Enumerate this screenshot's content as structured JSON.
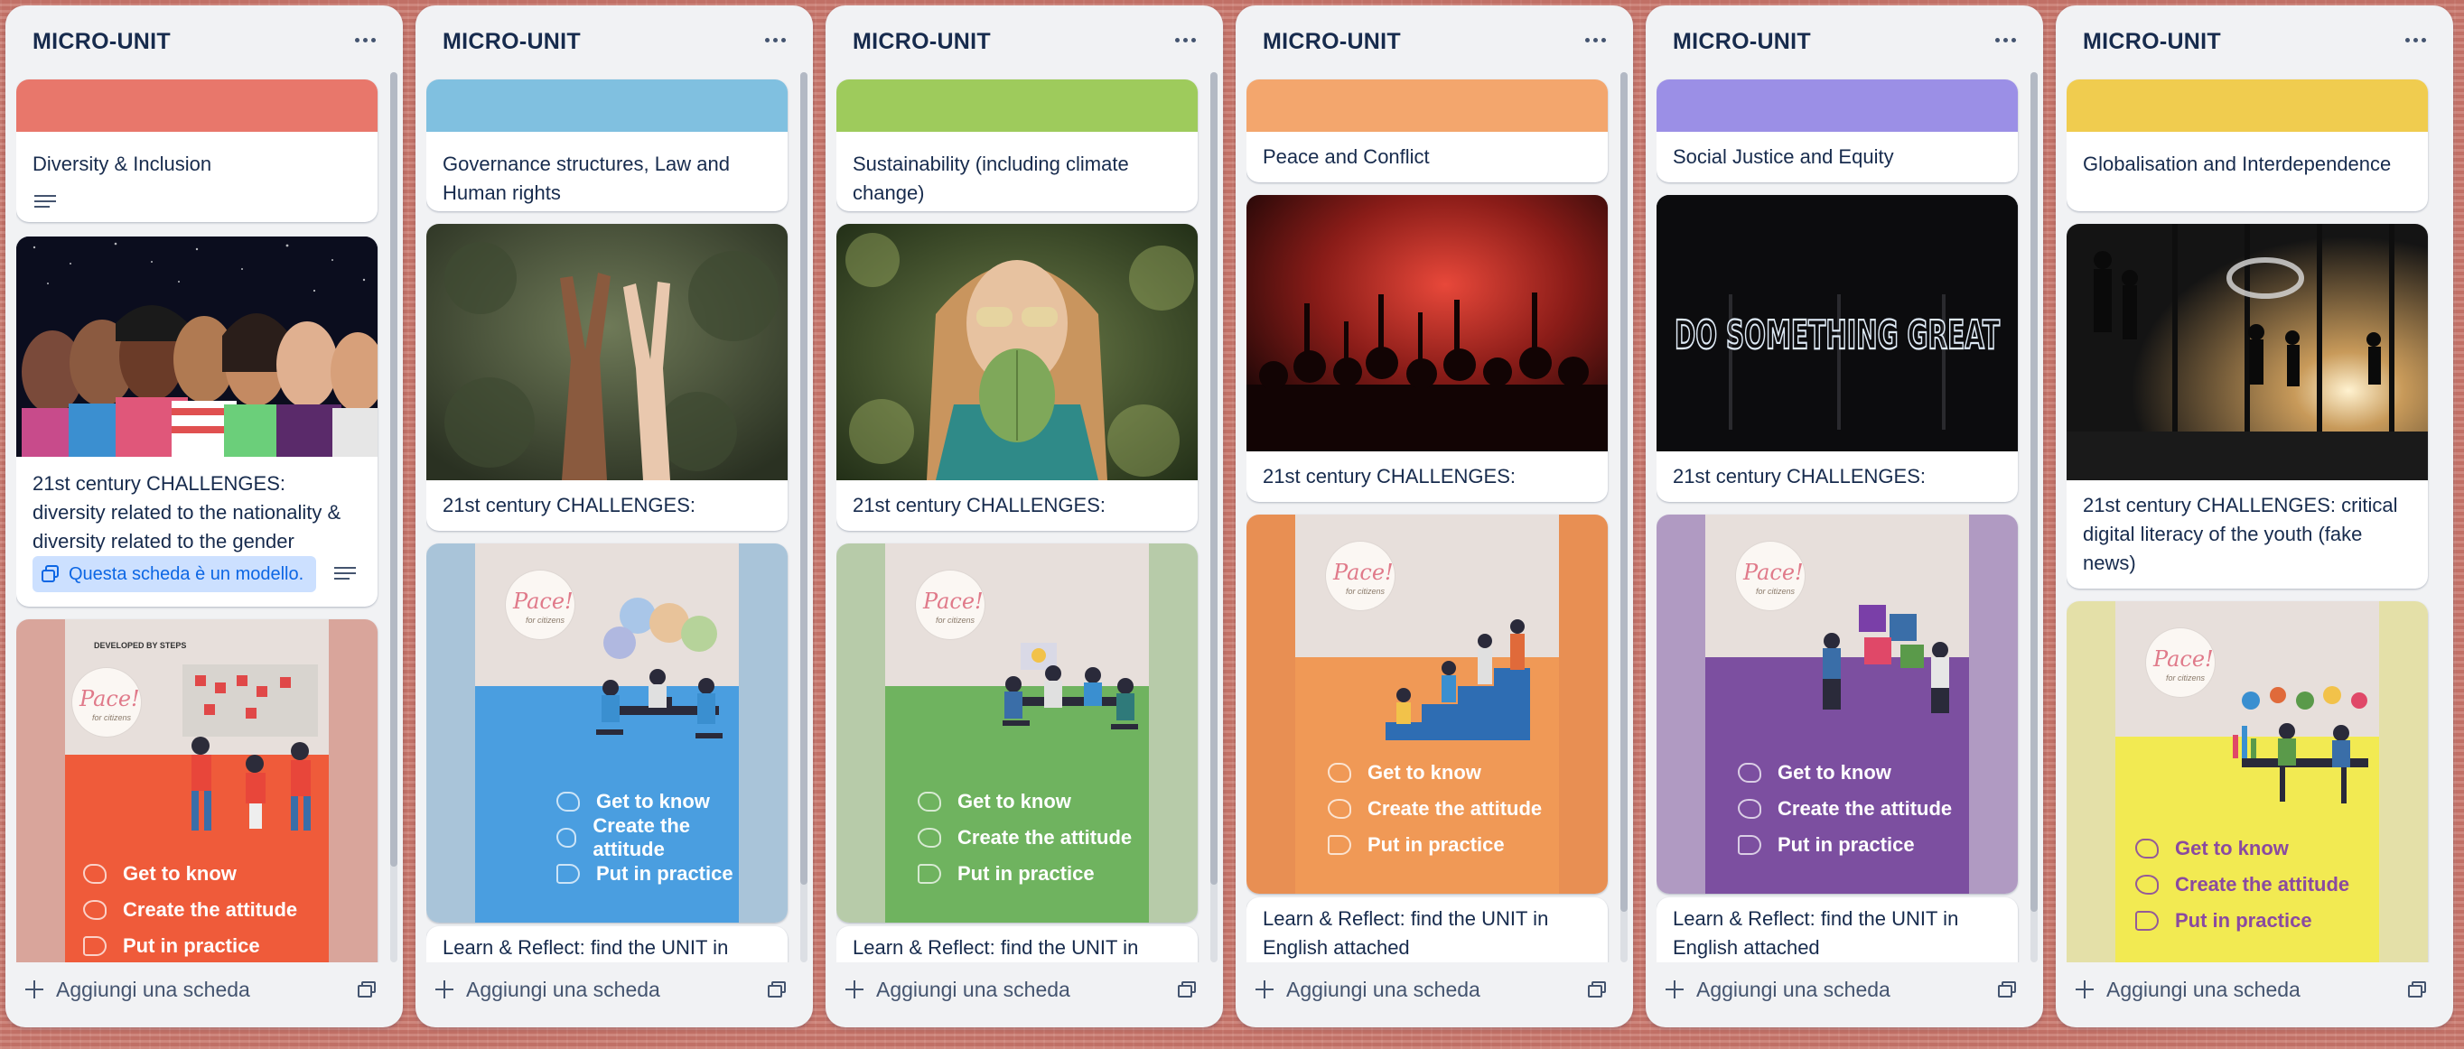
{
  "board": {
    "lists": [
      {
        "title": "MICRO-UNIT",
        "add_card": "Aggiungi una scheda",
        "cards": [
          {
            "kind": "cover-text",
            "cover_color": "#e8776b",
            "title": "Diversity & Inclusion",
            "has_description": true
          },
          {
            "kind": "image-text",
            "image": "illustration-diverse-faces",
            "title": "21st century CHALLENGES: diversity related to the nationality & diversity related to the gender",
            "template_badge": "Questa scheda è un modello.",
            "has_description": true
          },
          {
            "kind": "poster",
            "color": "#ef5b3a",
            "side": "#d9a59b",
            "developed_by": "DEVELOPED BY STEPS",
            "items": [
              "Get to know",
              "Create the attitude",
              "Put in practice"
            ]
          }
        ]
      },
      {
        "title": "MICRO-UNIT",
        "add_card": "Aggiungi una scheda",
        "cards": [
          {
            "kind": "cover-text",
            "cover_color": "#80c0e0",
            "title": "Governance structures, Law and Human rights"
          },
          {
            "kind": "image-text",
            "image": "photo-peace-hands",
            "title": "21st century CHALLENGES:"
          },
          {
            "kind": "poster",
            "color": "#4a9ee0",
            "side": "#a9c4d9",
            "items": [
              "Get to know",
              "Create the attitude",
              "Put in practice"
            ]
          },
          {
            "kind": "text",
            "title": "Learn & Reflect: find the UNIT in"
          }
        ]
      },
      {
        "title": "MICRO-UNIT",
        "add_card": "Aggiungi una scheda",
        "cards": [
          {
            "kind": "cover-text",
            "cover_color": "#9ecb5c",
            "title": "Sustainability (including climate change)"
          },
          {
            "kind": "image-text",
            "image": "photo-woman-leaf",
            "title": "21st century CHALLENGES:"
          },
          {
            "kind": "poster",
            "color": "#6fb35f",
            "side": "#b7cba9",
            "items": [
              "Get to know",
              "Create the attitude",
              "Put in practice"
            ]
          },
          {
            "kind": "text",
            "title": "Learn & Reflect: find the UNIT in"
          }
        ]
      },
      {
        "title": "MICRO-UNIT",
        "add_card": "Aggiungi una scheda",
        "cards": [
          {
            "kind": "cover-text",
            "cover_color": "#f3a66d",
            "title": "Peace and Conflict"
          },
          {
            "kind": "image-text",
            "image": "photo-crowd-red",
            "title": "21st century CHALLENGES:"
          },
          {
            "kind": "poster",
            "color": "#f09956",
            "side": "#e88f53",
            "items": [
              "Get to know",
              "Create the attitude",
              "Put in practice"
            ]
          },
          {
            "kind": "text",
            "title": "Learn & Reflect: find the UNIT in English attached"
          }
        ]
      },
      {
        "title": "MICRO-UNIT",
        "add_card": "Aggiungi una scheda",
        "cards": [
          {
            "kind": "cover-text",
            "cover_color": "#9b8fe6",
            "title": "Social Justice and Equity"
          },
          {
            "kind": "image-text",
            "image": "photo-neon-sign",
            "neon_text": "DO SOMETHING GREAT",
            "title": "21st century CHALLENGES:"
          },
          {
            "kind": "poster",
            "color": "#7c4fa0",
            "side": "#b09ac2",
            "items": [
              "Get to know",
              "Create the attitude",
              "Put in practice"
            ]
          },
          {
            "kind": "text",
            "title": "Learn & Reflect: find the UNIT in English attached"
          }
        ]
      },
      {
        "title": "MICRO-UNIT",
        "add_card": "Aggiungi una scheda",
        "cards": [
          {
            "kind": "cover-text",
            "cover_color": "#f0cc4f",
            "title": "Globalisation and Interdependence"
          },
          {
            "kind": "image-text",
            "image": "photo-airport-silhouettes",
            "title": "21st century CHALLENGES: critical digital literacy of the youth (fake news)"
          },
          {
            "kind": "poster",
            "color": "#f2ea52",
            "side": "#e4e0a8",
            "text_color": "#8a4aa0",
            "items": [
              "Get to know",
              "Create the attitude",
              "Put in practice"
            ]
          }
        ]
      }
    ]
  }
}
